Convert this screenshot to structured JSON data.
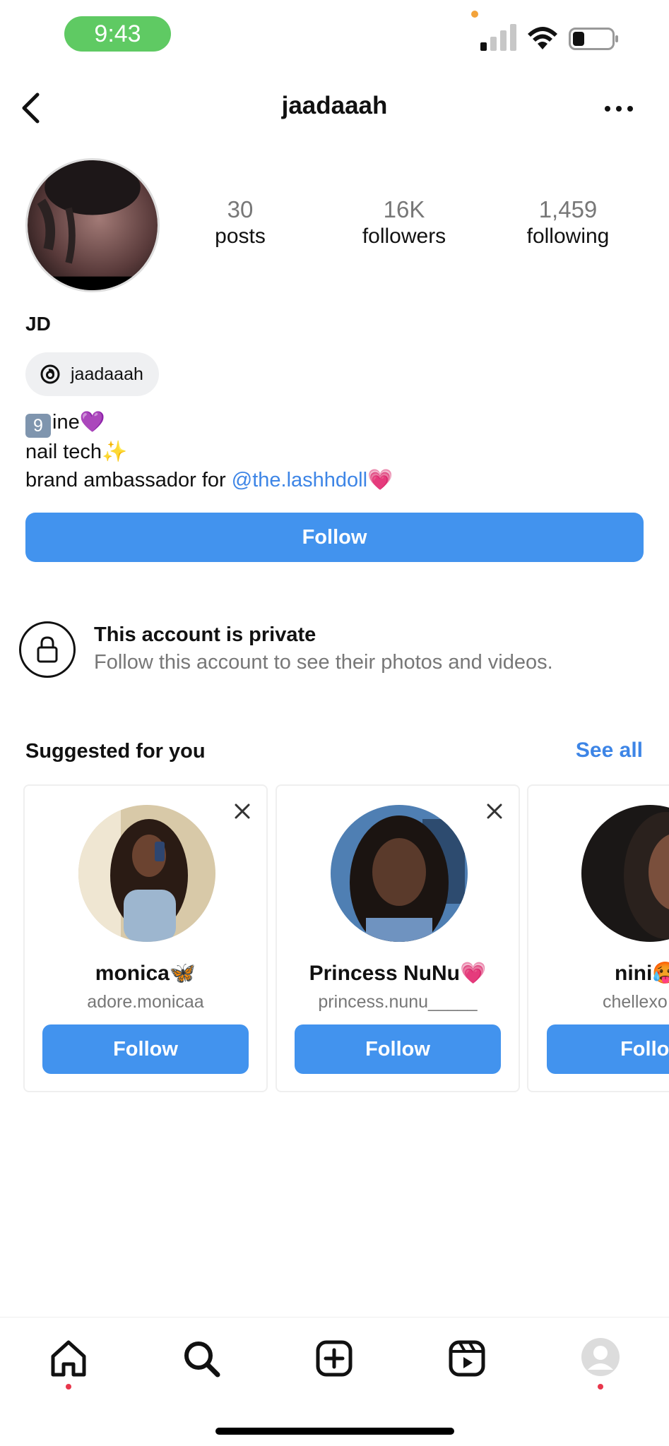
{
  "status_bar": {
    "time": "9:43"
  },
  "header": {
    "username": "jaadaaah"
  },
  "profile": {
    "stats": [
      {
        "value": "30",
        "label": "posts"
      },
      {
        "value": "16K",
        "label": "followers"
      },
      {
        "value": "1,459",
        "label": "following"
      }
    ],
    "display_name": "JD",
    "threads_handle": "jaadaaah",
    "bio": {
      "line1_box": "9",
      "line1_text": "ine💜",
      "line2": "nail tech✨",
      "line3_prefix": "brand ambassador for ",
      "line3_mention": "@the.lashhdoll",
      "line3_suffix": "💗"
    },
    "follow_label": "Follow"
  },
  "private": {
    "title": "This account is private",
    "subtitle": "Follow this account to see their photos and videos."
  },
  "suggested": {
    "title": "Suggested for you",
    "see_all": "See all",
    "cards": [
      {
        "name": "monica🦋",
        "username": "adore.monicaa",
        "follow": "Follow"
      },
      {
        "name": "Princess NuNu💗",
        "username": "princess.nunu_____",
        "follow": "Follow"
      },
      {
        "name": "nini🥵",
        "username": "chellexo",
        "follow": "Follow"
      }
    ]
  },
  "tabbar": {
    "icons": [
      "home-icon",
      "search-icon",
      "create-icon",
      "reels-icon",
      "profile-icon"
    ]
  },
  "colors": {
    "accent": "#4293ee",
    "link": "#3d85e6",
    "status_green": "#5fca63",
    "notify_dot": "#e8374c"
  }
}
